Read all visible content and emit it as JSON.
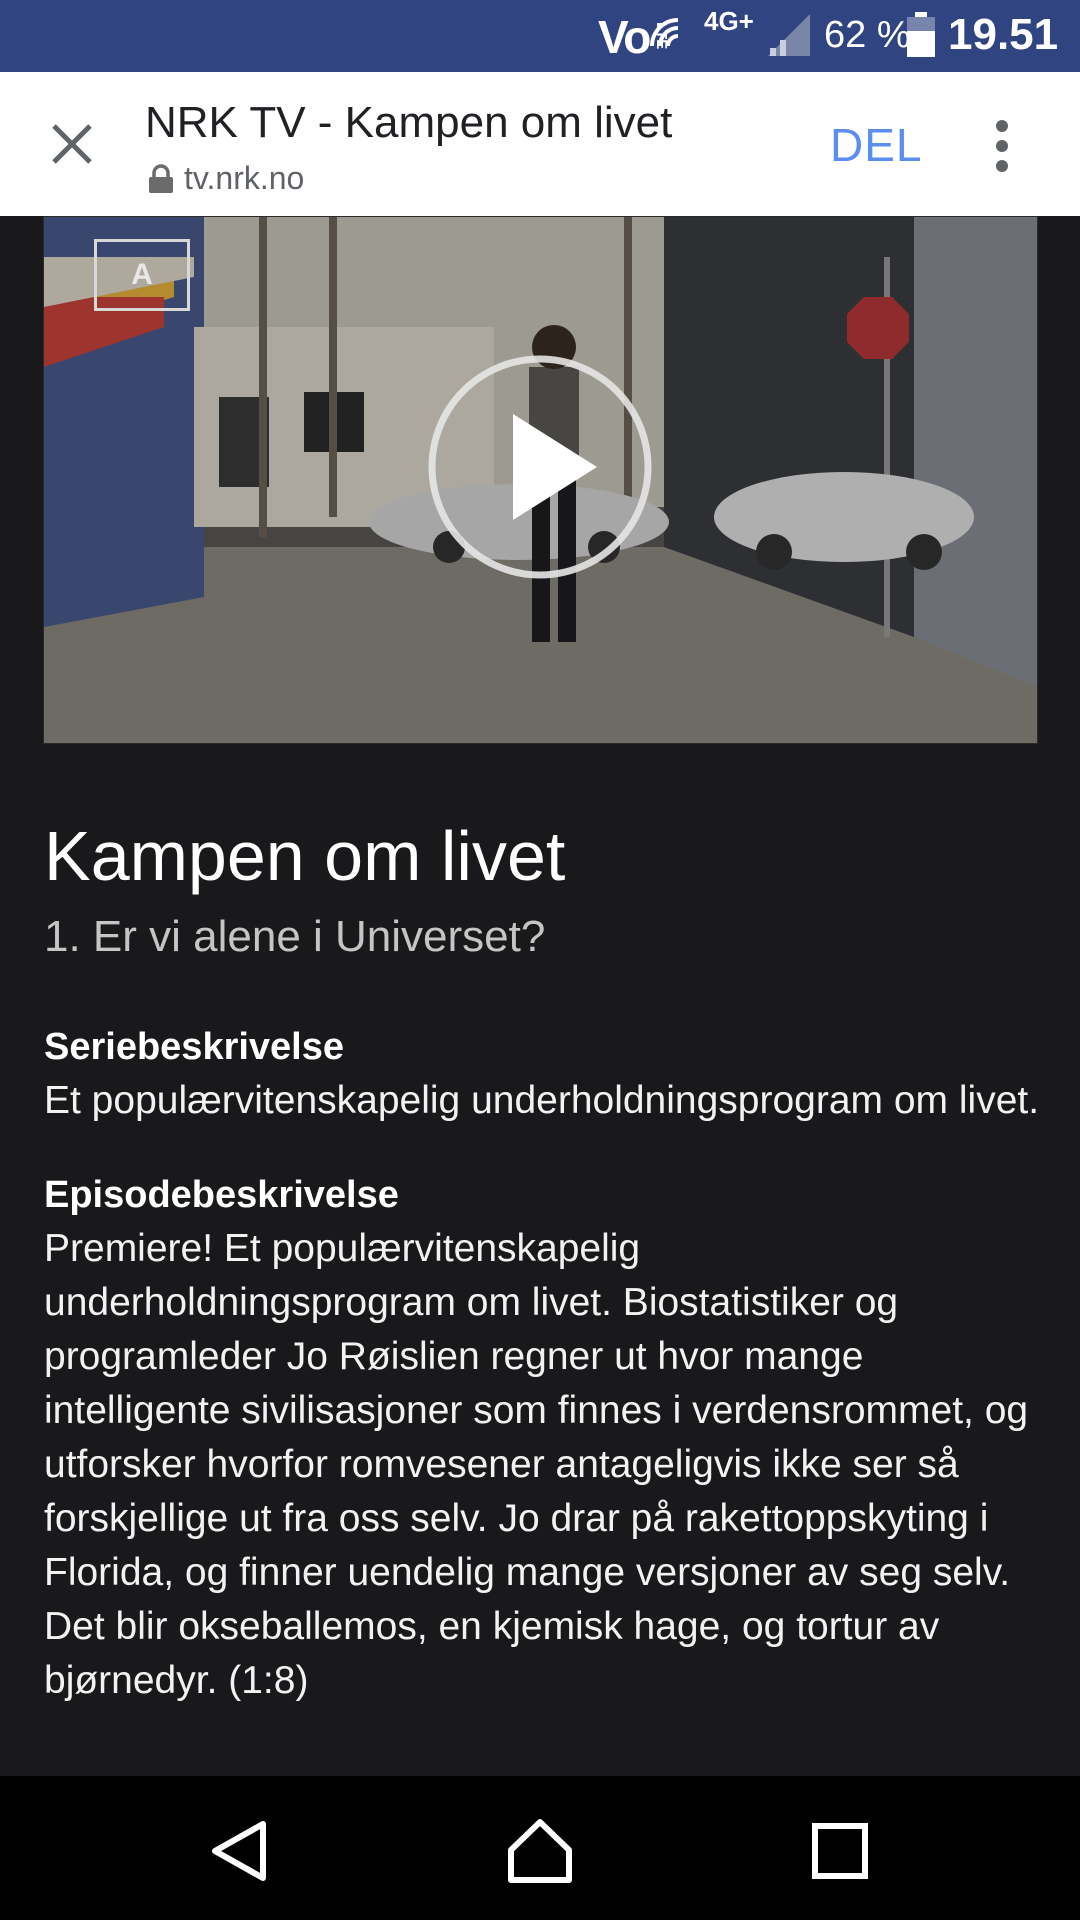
{
  "status_bar": {
    "volte": "Vo",
    "lte": "LTE",
    "network": "4G+",
    "battery_percent": "62 %",
    "time": "19.51"
  },
  "toolbar": {
    "close_icon": "close-icon",
    "title": "NRK TV - Kampen om livet",
    "url": "tv.nrk.no",
    "share_label": "DEL",
    "menu_icon": "more-vert-icon"
  },
  "video": {
    "rating": "A",
    "play_icon": "play-icon"
  },
  "program": {
    "title": "Kampen om livet",
    "episode": "1. Er vi alene i Universet?",
    "series_heading": "Seriebeskrivelse",
    "series_text": "Et populærvitenskapelig underholdningsprogram om livet.",
    "episode_heading": "Episodebeskrivelse",
    "episode_text": "Premiere! Et populærvitenskapelig underholdningsprogram om livet. Biostatistiker og programleder Jo Røislien regner ut hvor mange intelligente sivilisasjoner som finnes i verdensrommet, og utforsker hvorfor romvesener antageligvis ikke ser så forskjellige ut fra oss selv. Jo drar på rakettoppskyting i Florida, og finner uendelig mange versjoner av seg selv. Det blir okseballemos, en kjemisk hage, og tortur av bjørnedyr. (1:8)"
  },
  "navbar": {
    "back_icon": "back-icon",
    "home_icon": "home-icon",
    "recents_icon": "recents-icon"
  }
}
